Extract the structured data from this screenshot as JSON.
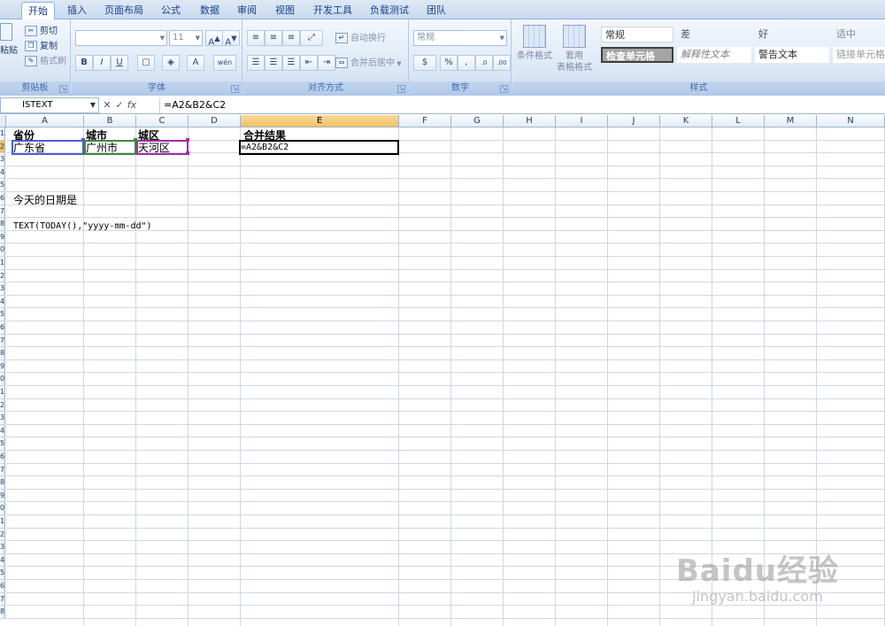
{
  "tabs": [
    "开始",
    "插入",
    "页面布局",
    "公式",
    "数据",
    "审阅",
    "视图",
    "开发工具",
    "负载测试",
    "团队"
  ],
  "clipboard": {
    "cut": "剪切",
    "copy": "复制",
    "format_painter": "格式刷",
    "paste": "粘贴",
    "label": "剪贴板"
  },
  "font": {
    "name_value": "",
    "size_value": "11",
    "label": "字体"
  },
  "alignment": {
    "wrap": "自动换行",
    "merge": "合并后居中",
    "label": "对齐方式"
  },
  "number": {
    "format_value": "常规",
    "label": "数字"
  },
  "styles_group": {
    "conditional": "条件格式",
    "table_format_1": "套用",
    "table_format_2": "表格格式",
    "label": "样式",
    "cells": [
      "常规",
      "差",
      "好",
      "适中",
      "检查单元格",
      "解释性文本",
      "警告文本",
      "链接单元格"
    ]
  },
  "formula_bar": {
    "name_box": "ISTEXT",
    "formula": "=A2&B2&C2"
  },
  "columns": [
    "A",
    "B",
    "C",
    "D",
    "E",
    "F",
    "G",
    "H",
    "I",
    "J",
    "K",
    "L",
    "M",
    "N"
  ],
  "row_numbers": [
    "1",
    "2",
    "3",
    "4",
    "5",
    "6",
    "7",
    "8",
    "9",
    "0",
    "1",
    "2",
    "3",
    "4",
    "5",
    "6",
    "7",
    "8",
    "9",
    "0",
    "1",
    "2",
    "3",
    "4",
    "5",
    "6",
    "7",
    "8",
    "9",
    "0",
    "1",
    "2",
    "3",
    "4",
    "5",
    "6",
    "7",
    "8"
  ],
  "cells": {
    "A1": "省份",
    "B1": "城市",
    "C1": "城区",
    "E1": "合并结果",
    "A2": "广东省",
    "B2": "广州市",
    "C2": "天河区",
    "E2": "=A2&B2&C2",
    "A6": "今天的日期是",
    "A8": "TEXT(TODAY(),\"yyyy-mm-dd\")"
  },
  "watermark": {
    "brand": "Baidu经验",
    "url": "jingyan.baidu.com"
  }
}
